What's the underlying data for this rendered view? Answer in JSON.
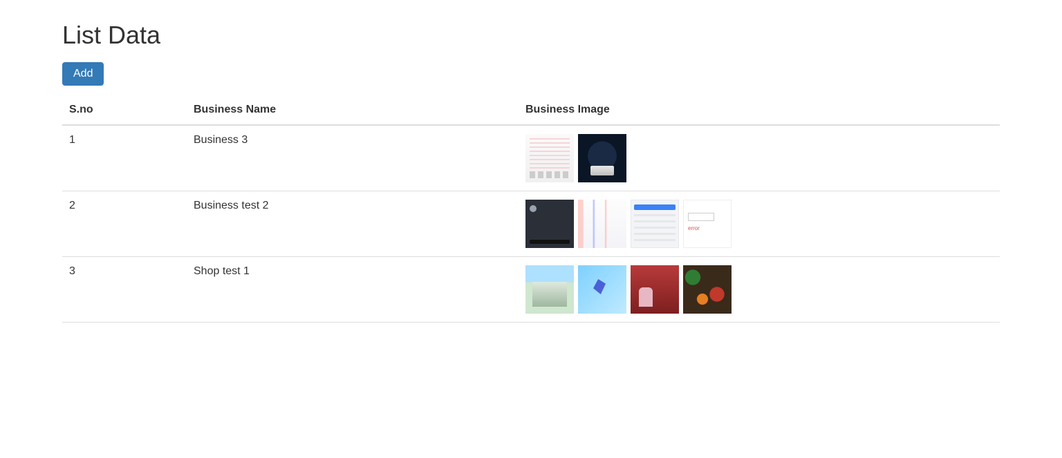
{
  "page": {
    "title": "List Data",
    "add_label": "Add"
  },
  "table": {
    "headers": {
      "sno": "S.no",
      "name": "Business Name",
      "image": "Business Image"
    },
    "rows": [
      {
        "sno": "1",
        "name": "Business 3",
        "thumbs": [
          "ph-text",
          "ph-hooded"
        ]
      },
      {
        "sno": "2",
        "name": "Business test 2",
        "thumbs": [
          "ph-dark-profile",
          "ph-abstract-lines",
          "ph-browser",
          "ph-form"
        ]
      },
      {
        "sno": "3",
        "name": "Shop test 1",
        "thumbs": [
          "ph-building",
          "ph-flying",
          "ph-redroom",
          "ph-spices"
        ]
      }
    ]
  }
}
